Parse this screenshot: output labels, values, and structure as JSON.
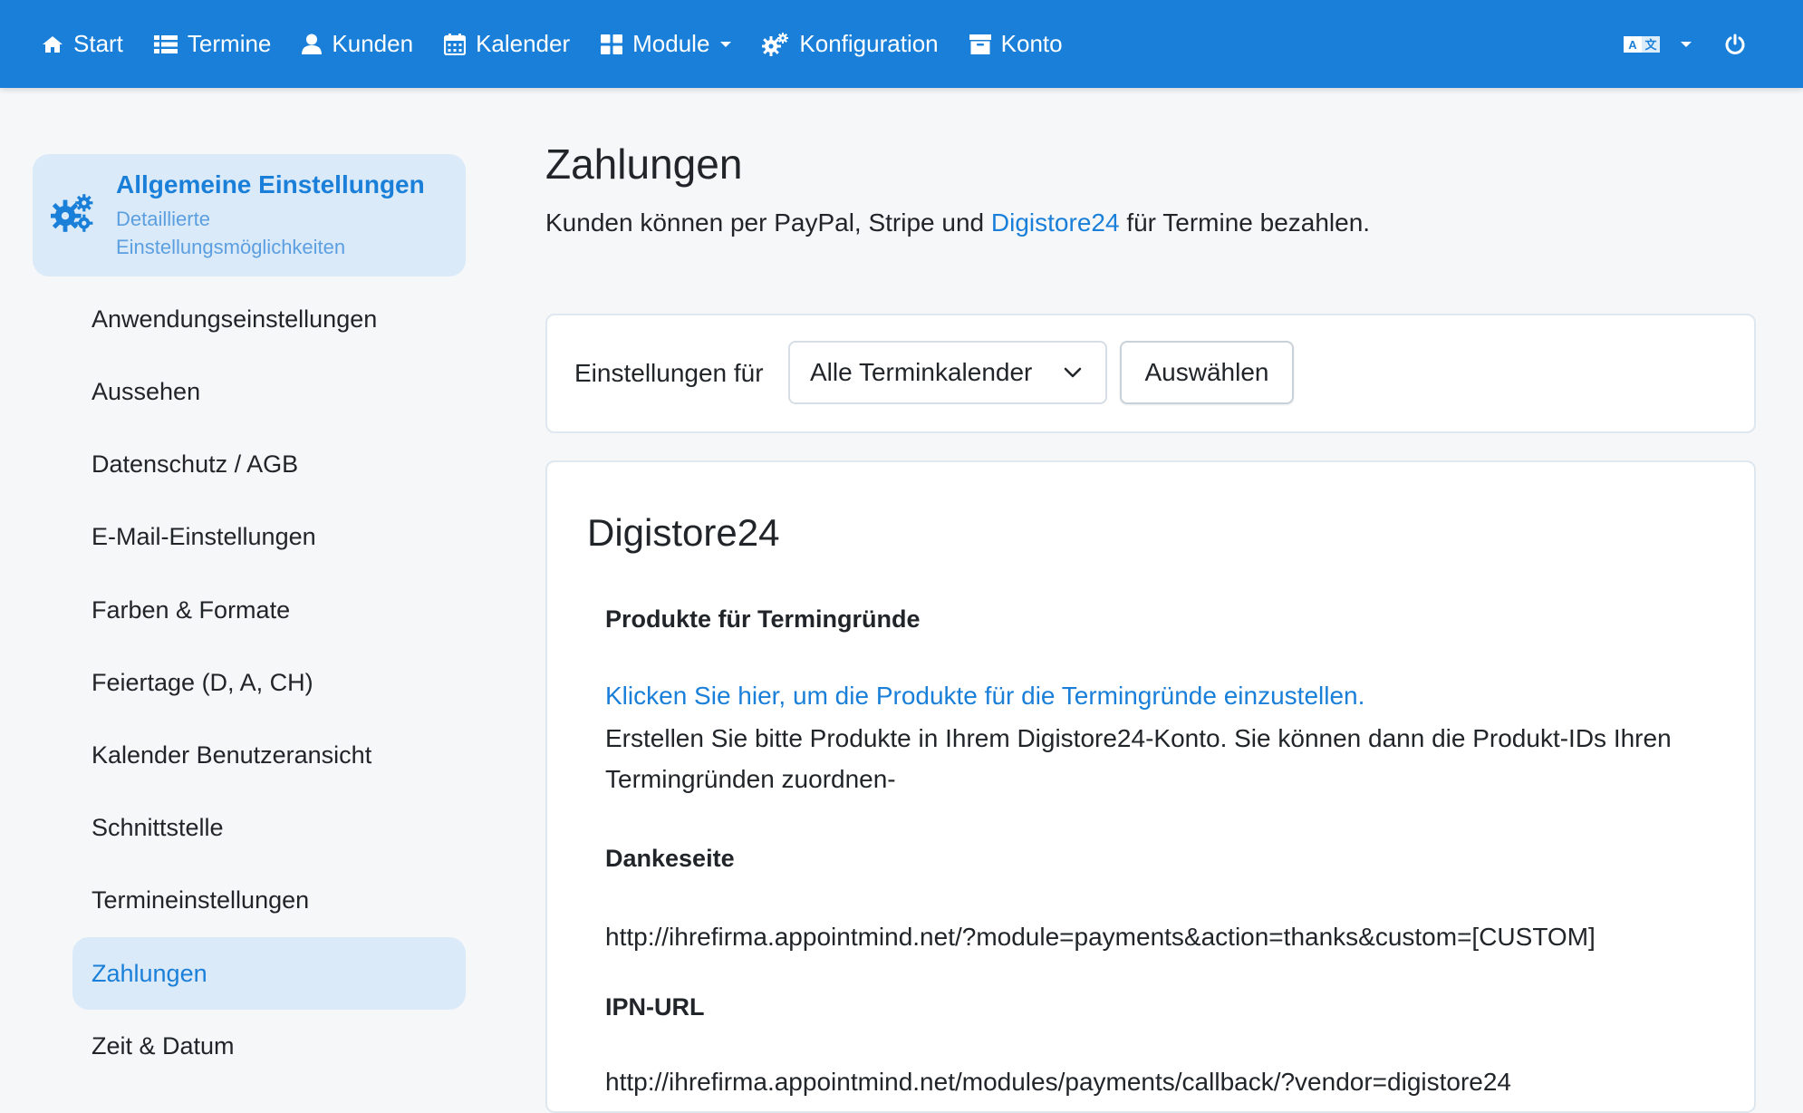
{
  "nav": {
    "items": [
      {
        "label": "Start",
        "icon": "home-icon"
      },
      {
        "label": "Termine",
        "icon": "list-icon"
      },
      {
        "label": "Kunden",
        "icon": "user-icon"
      },
      {
        "label": "Kalender",
        "icon": "calendar-icon"
      },
      {
        "label": "Module",
        "icon": "grid-icon"
      },
      {
        "label": "Konfiguration",
        "icon": "gears-icon"
      },
      {
        "label": "Konto",
        "icon": "archive-icon"
      }
    ]
  },
  "sidebar": {
    "header_title": "Allgemeine Einstellungen",
    "header_subtitle": "Detaillierte Einstellungsmöglichkeiten",
    "items": [
      {
        "label": "Anwendungseinstellungen"
      },
      {
        "label": "Aussehen"
      },
      {
        "label": "Datenschutz / AGB"
      },
      {
        "label": "E-Mail-Einstellungen"
      },
      {
        "label": "Farben & Formate"
      },
      {
        "label": "Feiertage (D, A, CH)"
      },
      {
        "label": "Kalender Benutzeransicht"
      },
      {
        "label": "Schnittstelle"
      },
      {
        "label": "Termineinstellungen"
      },
      {
        "label": "Zahlungen"
      },
      {
        "label": "Zeit & Datum"
      }
    ]
  },
  "main": {
    "title": "Zahlungen",
    "intro_before": "Kunden können per PayPal, Stripe und ",
    "intro_link": "Digistore24",
    "intro_after": " für Termine bezahlen.",
    "settings_for_label": "Einstellungen für",
    "calendar_select_value": "Alle Terminkalender",
    "select_button_label": "Auswählen",
    "card_title": "Digistore24",
    "products_heading": "Produkte für Termingründe",
    "products_link": "Klicken Sie hier, um die Produkte für die Termingründe einzustellen.",
    "products_text": "Erstellen Sie bitte Produkte in Ihrem Digistore24-Konto. Sie können dann die Produkt-IDs Ihren Termingründen zuordnen-",
    "thanks_heading": "Dankeseite",
    "thanks_url": "http://ihrefirma.appointmind.net/?module=payments&action=thanks&custom=[CUSTOM]",
    "ipn_heading": "IPN-URL",
    "ipn_url": "http://ihrefirma.appointmind.net/modules/payments/callback/?vendor=digistore24"
  },
  "colors": {
    "primary": "#1a7fd8",
    "sidebar_active_bg": "#dbeaf8",
    "page_bg": "#f5f7f9"
  }
}
